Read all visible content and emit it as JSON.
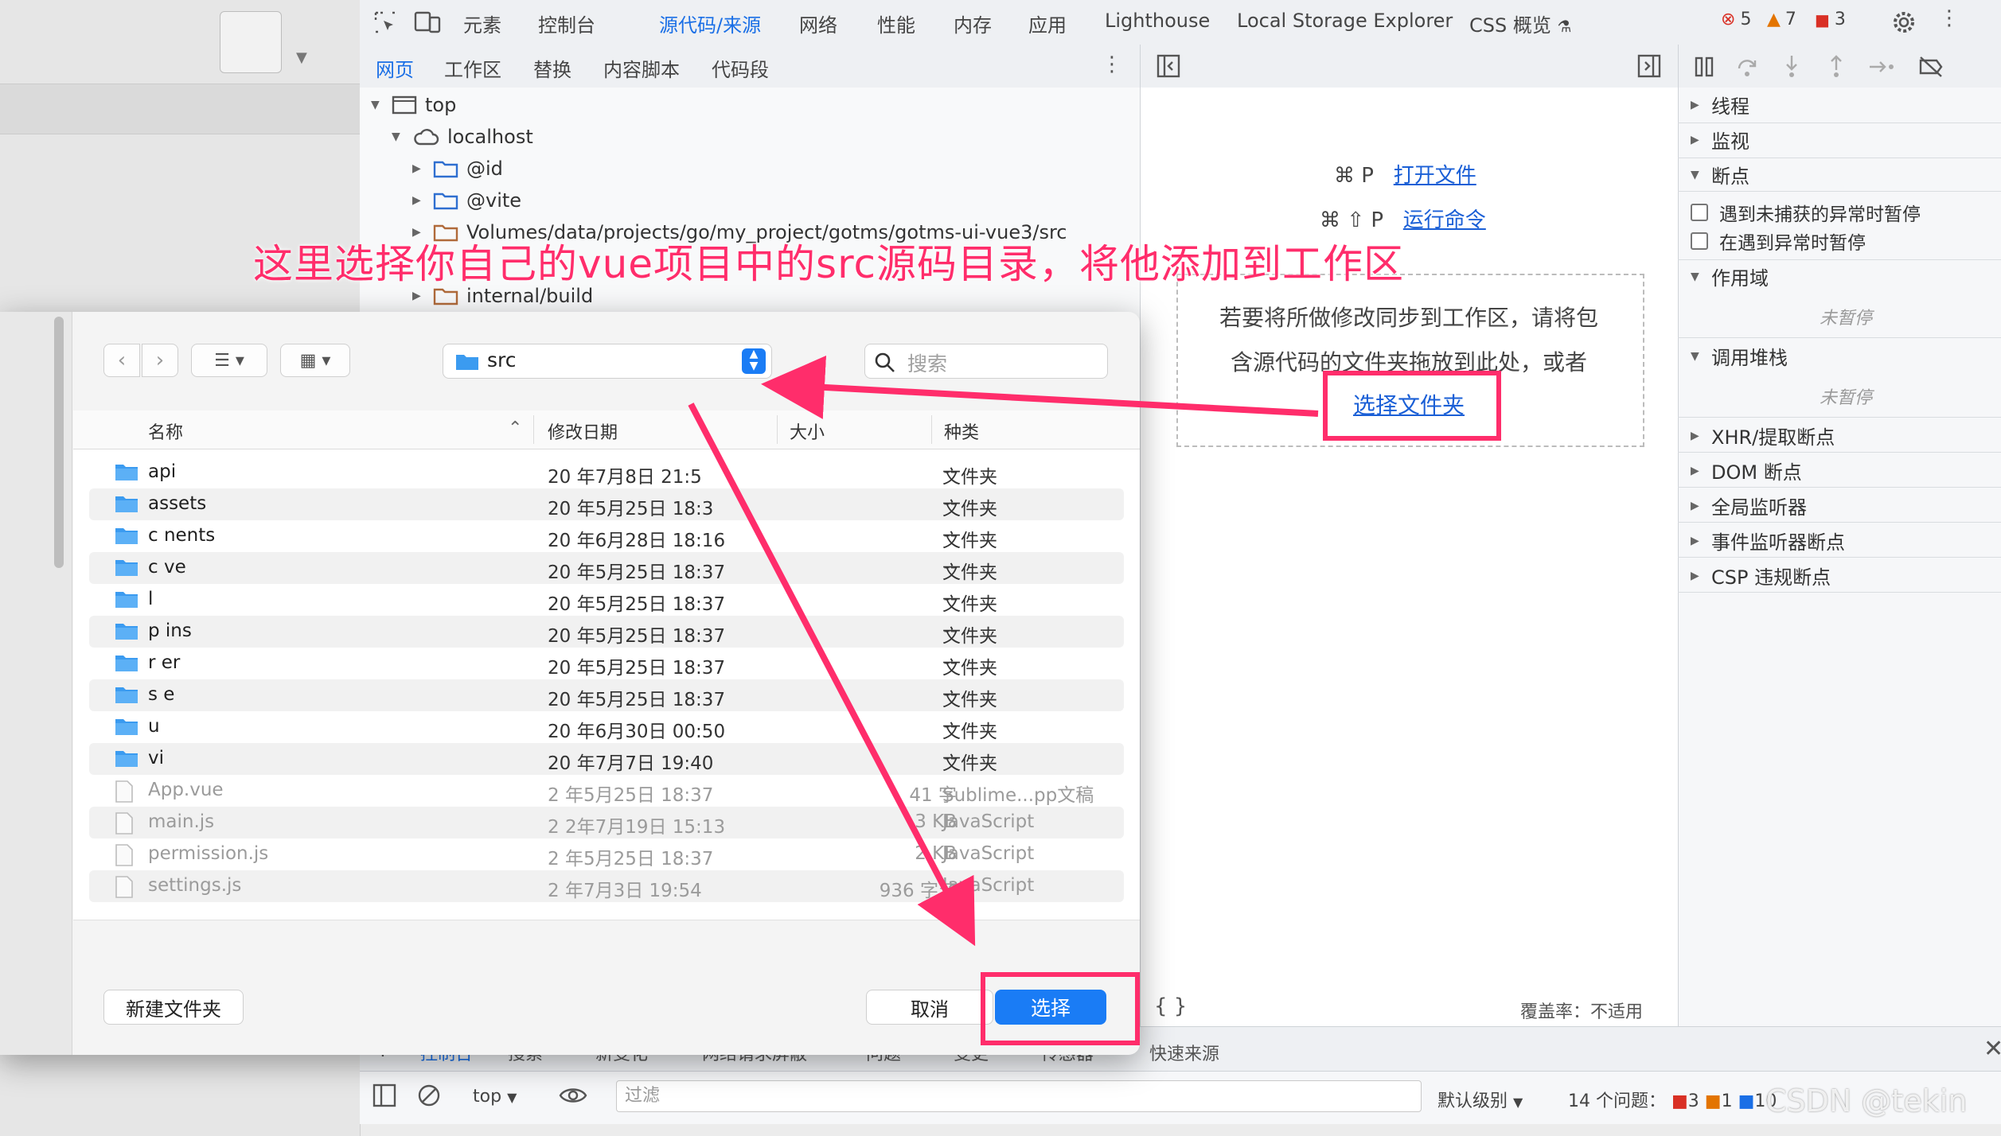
{
  "devtools": {
    "tabs": [
      "元素",
      "控制台",
      "源代码/来源",
      "网络",
      "性能",
      "内存",
      "应用",
      "Lighthouse",
      "Local Storage Explorer",
      "CSS 概览"
    ],
    "active_tab": "源代码/来源",
    "status": {
      "errors": "5",
      "warnings": "7",
      "issues": "3"
    }
  },
  "sources": {
    "subtabs": [
      "网页",
      "工作区",
      "替换",
      "内容脚本",
      "代码段"
    ],
    "active_subtab": "网页",
    "tree": [
      "top",
      "localhost",
      "@id",
      "@vite",
      "Volumes/data/projects/go/my_project/gotms/gotms-ui-vue3/src",
      "internal/build"
    ]
  },
  "editor": {
    "open_file_keys": "⌘ P",
    "open_file_label": "打开文件",
    "run_cmd_keys": "⌘ ⇧ P",
    "run_cmd_label": "运行命令",
    "workspace_hint_line1": "若要将所做修改同步到工作区，请将包",
    "workspace_hint_line2": "含源代码的文件夹拖放到此处，或者",
    "choose_folder": "选择文件夹",
    "braces": "{ }",
    "coverage": "覆盖率：不适用"
  },
  "debugger": {
    "threads": "线程",
    "watch": "监视",
    "breakpoints": "断点",
    "pause_uncaught": "遇到未捕获的异常时暂停",
    "pause_caught": "在遇到异常时暂停",
    "scope": "作用域",
    "not_paused_1": "未暂停",
    "call_stack": "调用堆栈",
    "not_paused_2": "未暂停",
    "xhr": "XHR/提取断点",
    "dom": "DOM 断点",
    "global_listeners": "全局监听器",
    "event_listeners": "事件监听器断点",
    "csp": "CSP 违规断点"
  },
  "drawer": {
    "tabs": [
      "控制台",
      "搜索",
      "新变化",
      "网络请求屏蔽",
      "问题",
      "变更",
      "传感器"
    ],
    "quick_source": "快速来源",
    "console_context": "top",
    "filter_placeholder": "过滤",
    "level": "默认级别",
    "issues": "14 个问题：",
    "issue_counts": [
      "3",
      "1",
      "10"
    ],
    "watermark": "CSDN @tekin"
  },
  "dialog": {
    "path": "src",
    "search_placeholder": "搜索",
    "columns": {
      "name": "名称",
      "date": "修改日期",
      "size": "大小",
      "kind": "种类"
    },
    "files": [
      {
        "name": "api",
        "date": "20  年7月8日 21:5",
        "size": "--",
        "kind": "文件夹",
        "type": "folder"
      },
      {
        "name": "assets",
        "date": "20  年5月25日 18:3",
        "size": "--",
        "kind": "文件夹",
        "type": "folder"
      },
      {
        "name": "c    nents",
        "date": "20  年6月28日 18:16",
        "size": "--",
        "kind": "文件夹",
        "type": "folder"
      },
      {
        "name": "c    ve",
        "date": "20  年5月25日 18:37",
        "size": "--",
        "kind": "文件夹",
        "type": "folder"
      },
      {
        "name": "l",
        "date": "20  年5月25日 18:37",
        "size": "--",
        "kind": "文件夹",
        "type": "folder"
      },
      {
        "name": "p    ins",
        "date": "20  年5月25日 18:37",
        "size": "--",
        "kind": "文件夹",
        "type": "folder"
      },
      {
        "name": "r    er",
        "date": "20  年5月25日 18:37",
        "size": "--",
        "kind": "文件夹",
        "type": "folder"
      },
      {
        "name": "s    e",
        "date": "20  年5月25日 18:37",
        "size": "--",
        "kind": "文件夹",
        "type": "folder"
      },
      {
        "name": "u",
        "date": "20  年6月30日 00:50",
        "size": "--",
        "kind": "文件夹",
        "type": "folder"
      },
      {
        "name": "vi",
        "date": "20  年7月7日 19:40",
        "size": "--",
        "kind": "文件夹",
        "type": "folder"
      },
      {
        "name": "App.vue",
        "date": "2   年5月25日 18:37",
        "size": "41 字",
        "kind": "Sublime...pp文稿",
        "type": "file"
      },
      {
        "name": "main.js",
        "date": "2  2年7月19日 15:13",
        "size": "3 KB",
        "kind": "JavaScript",
        "type": "file"
      },
      {
        "name": "permission.js",
        "date": "2   年5月25日 18:37",
        "size": "2 KB",
        "kind": "JavaScript",
        "type": "file"
      },
      {
        "name": "settings.js",
        "date": "2   年7月3日 19:54",
        "size": "936 字节",
        "kind": "JavaScript",
        "type": "file"
      }
    ],
    "new_folder": "新建文件夹",
    "cancel": "取消",
    "select": "选择"
  },
  "annotation": {
    "text": "这里选择你自己的vue项目中的src源码目录，将他添加到工作区",
    "color": "#ff2d6b"
  }
}
